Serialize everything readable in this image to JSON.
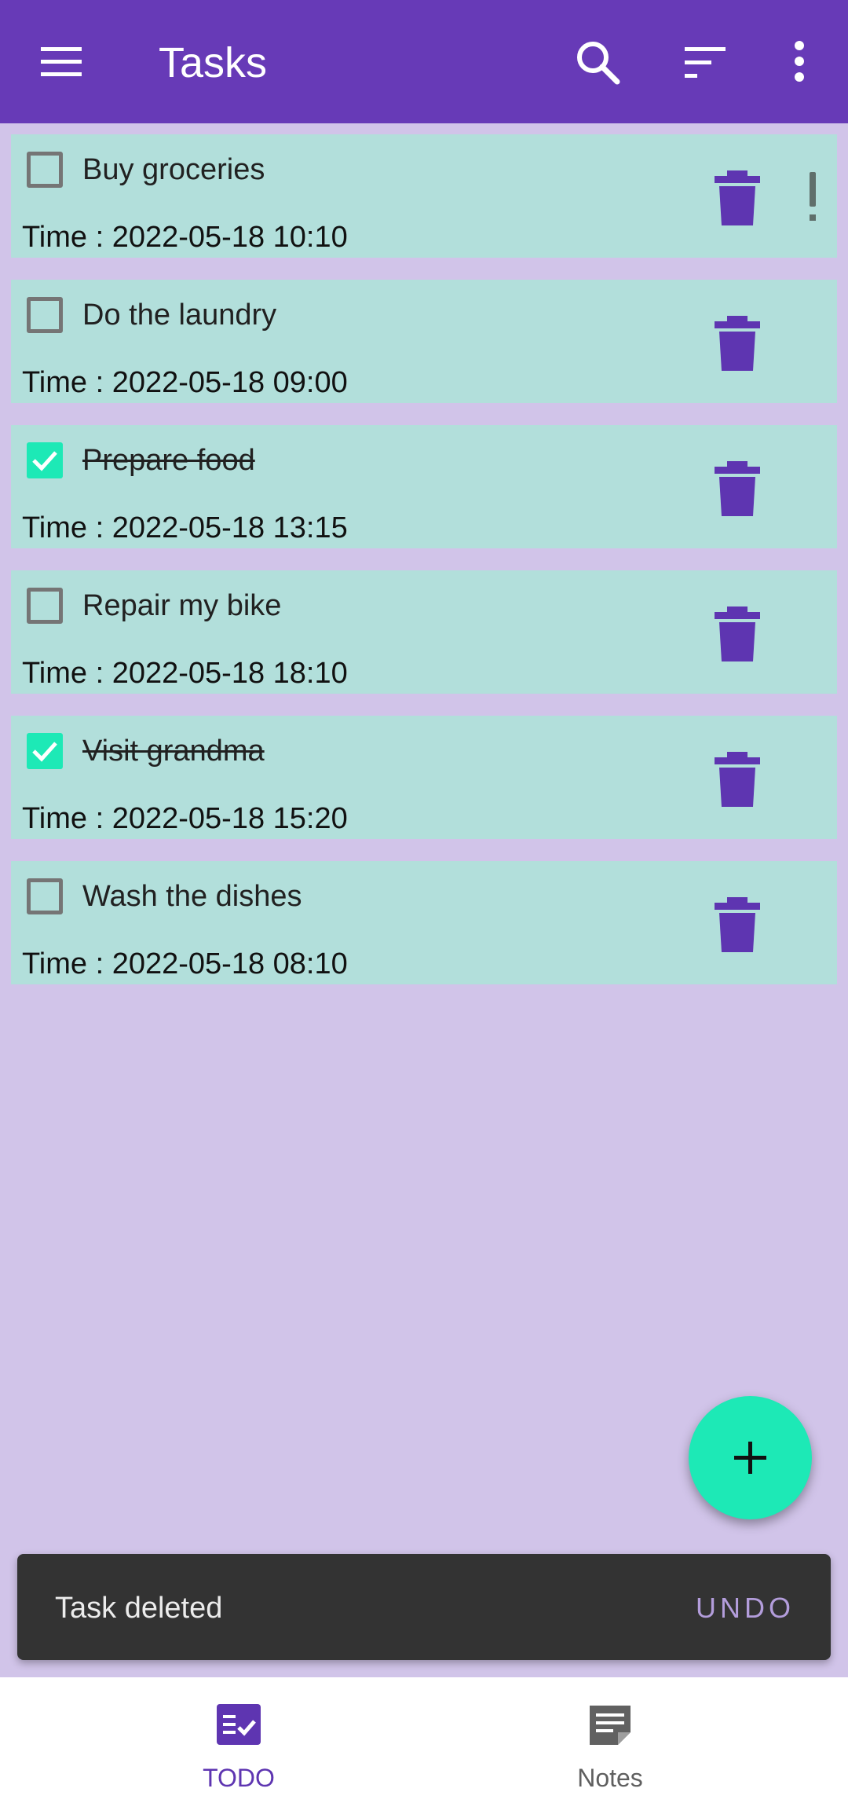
{
  "appbar": {
    "title": "Tasks",
    "icons": [
      "menu-icon",
      "search-icon",
      "sort-icon",
      "more-vert-icon"
    ],
    "color": "#673ab7"
  },
  "tasks": [
    {
      "title": "Buy groceries",
      "time": "Time : 2022-05-18 10:10",
      "checked": false,
      "priority": true
    },
    {
      "title": "Do the laundry",
      "time": "Time : 2022-05-18 09:00",
      "checked": false,
      "priority": false
    },
    {
      "title": "Prepare food",
      "time": "Time : 2022-05-18 13:15",
      "checked": true,
      "priority": false
    },
    {
      "title": "Repair my bike",
      "time": "Time : 2022-05-18 18:10",
      "checked": false,
      "priority": false
    },
    {
      "title": "Visit grandma",
      "time": "Time : 2022-05-18 15:20",
      "checked": true,
      "priority": false
    },
    {
      "title": "Wash the dishes",
      "time": "Time : 2022-05-18 08:10",
      "checked": false,
      "priority": false
    }
  ],
  "snackbar": {
    "message": "Task deleted",
    "action": "UNDO"
  },
  "bottom_nav": {
    "items": [
      {
        "label": "TODO",
        "icon": "todo-checklist-icon",
        "active": true
      },
      {
        "label": "Notes",
        "icon": "note-icon",
        "active": false
      }
    ]
  },
  "colors": {
    "primary": "#673ab7",
    "background": "#d1c4e9",
    "card": "#b2dfdb",
    "accent": "#1de9b6",
    "trash": "#5e35b1"
  }
}
